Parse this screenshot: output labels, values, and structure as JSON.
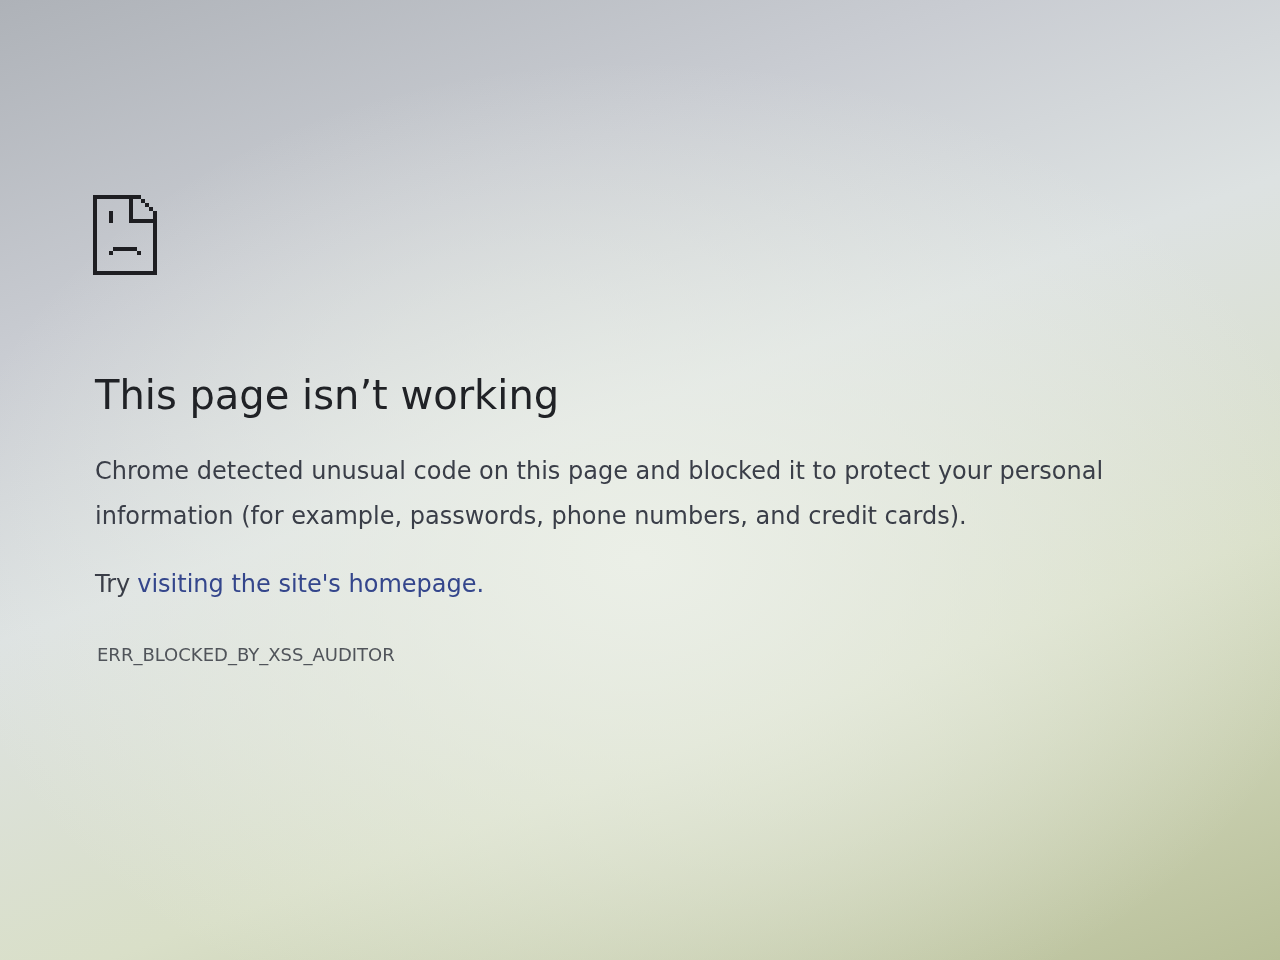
{
  "heading": "This page isn’t working",
  "message": "Chrome detected unusual code on this page and blocked it to protect your personal information (for example, passwords, phone numbers, and credit cards).",
  "suggestion": {
    "text": "Try",
    "link": "visiting the site's homepage."
  },
  "error_code": "ERR_BLOCKED_BY_XSS_AUDITOR"
}
